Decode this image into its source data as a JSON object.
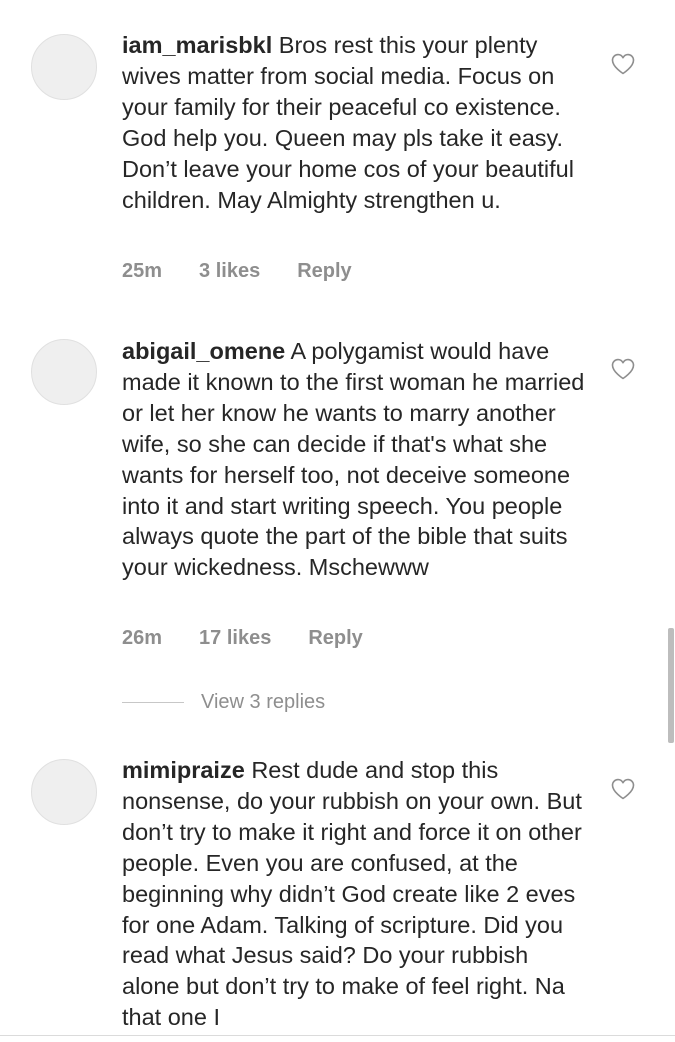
{
  "comments": [
    {
      "username": "iam_marisbkl",
      "text": "Bros rest this your plenty wives matter from social media. Focus on your family for their peaceful co existence. God help you. Queen may pls take it easy. Don’t leave your home cos of your beautiful children. May Almighty strengthen u.",
      "time": "25m",
      "likes": "3 likes",
      "reply": "Reply"
    },
    {
      "username": "abigail_omene",
      "text": "A polygamist would have made it known to the first woman he married or let her know he wants to marry another wife, so she can decide if that's what she wants for herself too, not deceive someone into it and start writing speech. You people always quote the part of the bible that suits your wickedness. Mschewww",
      "time": "26m",
      "likes": "17 likes",
      "reply": "Reply",
      "view_replies": "View 3 replies"
    },
    {
      "username": "mimipraize",
      "text": "Rest dude and stop this nonsense, do your rubbish on your own. But don’t try to make it right and force it on other people. Even you are confused, at the beginning why didn’t God create like 2 eves for one Adam. Talking of scripture. Did you read what Jesus said?  Do your rubbish alone but don’t try to make of feel right. Na that one I"
    }
  ],
  "icons": {
    "like": "heart-outline-icon",
    "avatar": "avatar-placeholder"
  },
  "colors": {
    "text": "#262626",
    "muted": "#8e8e8e",
    "avatar_bg": "#efefef",
    "scrollbar": "#bdbdbd"
  }
}
